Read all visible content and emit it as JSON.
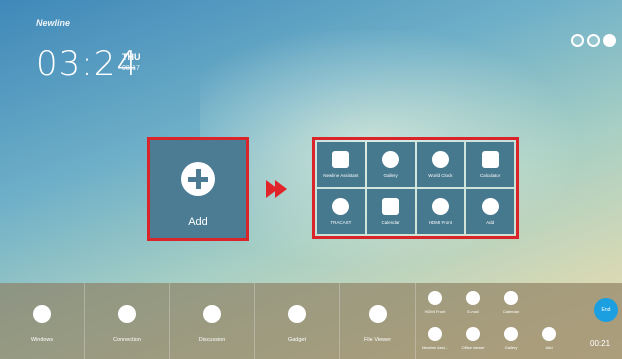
{
  "brand": "Newline",
  "clock": {
    "time": "03:24",
    "day": "THU",
    "date": "08-17"
  },
  "sidebar_text": "",
  "add_tile": {
    "label": "Add"
  },
  "apps": [
    {
      "label": "Newline Assistant",
      "icon": "cross-icon"
    },
    {
      "label": "Gallery",
      "icon": "gallery-icon"
    },
    {
      "label": "World Clock",
      "icon": "globe-icon"
    },
    {
      "label": "Calculator",
      "icon": "calculator-icon"
    },
    {
      "label": "TRACAST",
      "icon": "cast-icon"
    },
    {
      "label": "Calendar",
      "icon": "calendar-icon"
    },
    {
      "label": "HDMI Front",
      "icon": "hdmi-icon"
    },
    {
      "label": "Add",
      "icon": "plus-icon"
    }
  ],
  "taskbar": [
    {
      "label": "Windows",
      "icon": "monitor-icon"
    },
    {
      "label": "Connection",
      "icon": "connection-icon"
    },
    {
      "label": "Discussion",
      "icon": "discussion-icon"
    },
    {
      "label": "Gadget",
      "icon": "grid-icon"
    },
    {
      "label": "File Viewer",
      "icon": "file-icon"
    }
  ],
  "quick_apps": [
    {
      "label": "HDMI Front",
      "icon": "hdmi-icon"
    },
    {
      "label": "E-mail",
      "icon": "mail-icon"
    },
    {
      "label": "Calendar",
      "icon": "calendar-icon"
    },
    {
      "label": "Newline Assi...",
      "icon": "cross-icon"
    },
    {
      "label": "Office viewer",
      "icon": "office-icon"
    },
    {
      "label": "Gallery",
      "icon": "gallery-icon"
    },
    {
      "label": "Add",
      "icon": "plus-icon"
    }
  ],
  "end": {
    "label": "End",
    "timer": "00:21"
  }
}
